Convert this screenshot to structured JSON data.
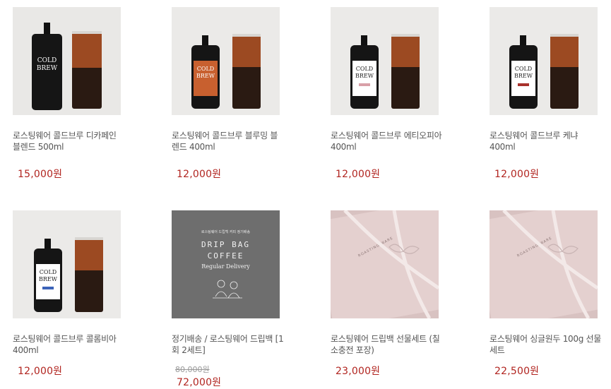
{
  "products": [
    {
      "name": "로스팅웨어 콜드브루 디카페인 블렌드 500ml",
      "price": "15,000원",
      "thumb": "bottle",
      "label_color": "#1a1a1a",
      "brand_line1": "COLD",
      "brand_line2": "BREW"
    },
    {
      "name": "로스팅웨어 콜드브루 블루밍 블렌드 400ml",
      "price": "12,000원",
      "thumb": "bottle",
      "label_color": "#c8602f",
      "brand_line1": "COLD",
      "brand_line2": "BREW"
    },
    {
      "name": "로스팅웨어 콜드브루 에티오피아 400ml",
      "price": "12,000원",
      "thumb": "bottle",
      "label_color": "#ffffff",
      "brand_line1": "COLD",
      "brand_line2": "BREW"
    },
    {
      "name": "로스팅웨어 콜드브루 케냐 400ml",
      "price": "12,000원",
      "thumb": "bottle",
      "label_color": "#ffffff",
      "brand_line1": "COLD",
      "brand_line2": "BREW"
    },
    {
      "name": "로스팅웨어 콜드브루 콜롬비아 400ml",
      "price": "12,000원",
      "thumb": "bottle",
      "label_color": "#ffffff",
      "brand_line1": "COLD",
      "brand_line2": "BREW"
    },
    {
      "name": "정기배송 / 로스팅웨어 드립백 [1회 2세트]",
      "original_price": "80,000원",
      "price": "72,000원",
      "thumb": "dripbag",
      "dripbag_small": "로스팅웨어 드립백 커피 정기배송",
      "dripbag_line1": "DRIP BAG",
      "dripbag_line2": "COFFEE",
      "dripbag_line3": "Regular Delivery"
    },
    {
      "name": "로스팅웨어 드립백 선물세트 (칠소충전 포장)",
      "price": "23,000원",
      "thumb": "gift",
      "gift_text": "ROASTING WARE"
    },
    {
      "name": "로스팅웨어 싱글원두 100g 선물세트",
      "price": "22,500원",
      "thumb": "gift",
      "gift_text": "ROASTING WARE"
    }
  ]
}
